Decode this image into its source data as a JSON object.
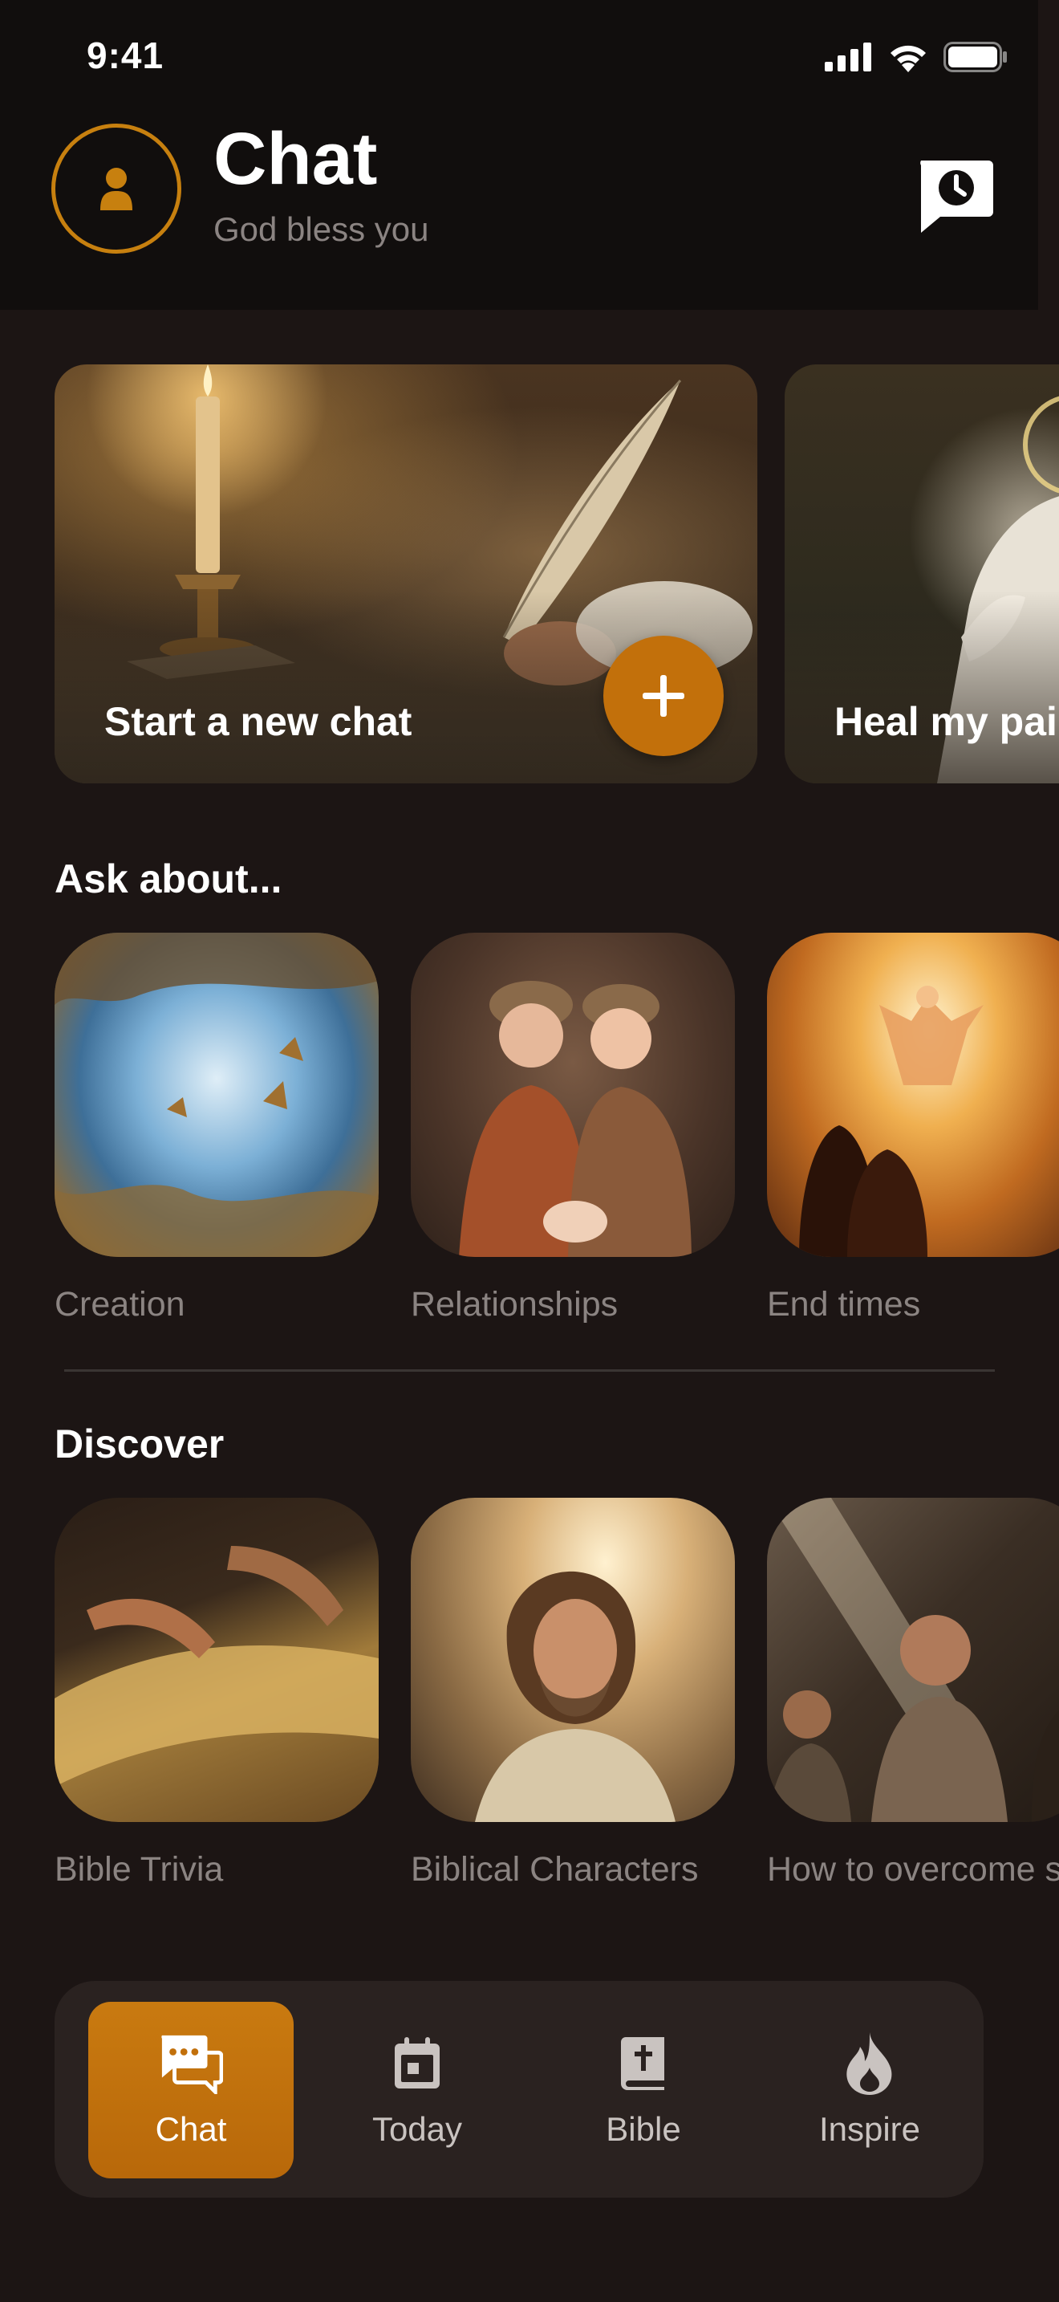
{
  "status_bar": {
    "time": "9:41"
  },
  "header": {
    "title": "Chat",
    "subtitle": "God bless you"
  },
  "hero_cards": [
    {
      "label": "Start a new chat"
    },
    {
      "label": "Heal my pai"
    }
  ],
  "ask_about": {
    "title": "Ask about...",
    "items": [
      {
        "label": "Creation"
      },
      {
        "label": "Relationships"
      },
      {
        "label": "End times"
      }
    ]
  },
  "discover": {
    "title": "Discover",
    "items": [
      {
        "label": "Bible Trivia"
      },
      {
        "label": "Biblical Characters"
      },
      {
        "label": "How to overcome sin"
      }
    ]
  },
  "tabbar": {
    "items": [
      {
        "label": "Chat",
        "icon": "chat-bubbles-icon",
        "active": true
      },
      {
        "label": "Today",
        "icon": "calendar-icon",
        "active": false
      },
      {
        "label": "Bible",
        "icon": "bible-icon",
        "active": false
      },
      {
        "label": "Inspire",
        "icon": "flame-icon",
        "active": false
      }
    ]
  },
  "colors": {
    "accent": "#c7800f",
    "background": "#1c1514",
    "header_bg": "#110e0d",
    "muted_text": "#8b8482"
  }
}
